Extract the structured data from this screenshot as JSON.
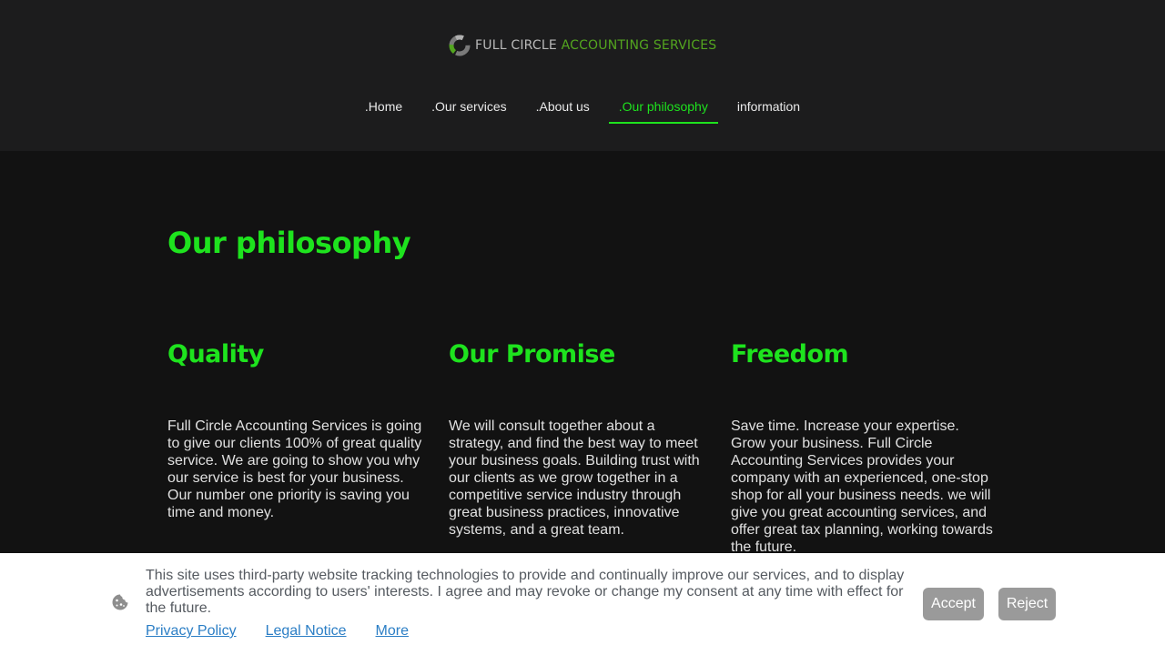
{
  "logo": {
    "part1": "FULL CIRCLE ",
    "part2": "ACCOUNTING SERVICES"
  },
  "nav": [
    {
      "label": ".Home"
    },
    {
      "label": ".Our services"
    },
    {
      "label": ".About us"
    },
    {
      "label": ".Our philosophy",
      "active": true
    },
    {
      "label": "information"
    }
  ],
  "page": {
    "title": "Our philosophy"
  },
  "columns": [
    {
      "heading": "Quality",
      "text": "Full Circle Accounting Services is going to give our clients 100% of great quality service. We are going to show you why our service is best for your business. Our number one priority is saving you time and money."
    },
    {
      "heading": "Our Promise",
      "text": "We will consult together about a strategy, and find the best way to meet your business goals. Building trust with our clients as we grow together in a competitive service industry through great business practices, innovative systems, and a great team."
    },
    {
      "heading": "Freedom",
      "text": "Save time. Increase your expertise. Grow your business. Full Circle Accounting Services provides your company with an experienced, one-stop shop for all your business needs. we will give you great accounting services, and offer great tax planning, working towards the future."
    }
  ],
  "cookie": {
    "text": "This site uses third-party website tracking technologies to provide and continually improve our services, and to display advertisements according to users' interests. I agree and may revoke or change my consent at any time with effect for the future.",
    "links": [
      "Privacy Policy",
      "Legal Notice",
      "More"
    ],
    "accept": "Accept",
    "reject": "Reject"
  },
  "icons": {
    "logo": "circle-arrows-logo-icon",
    "cookie": "cookie-icon"
  },
  "colors": {
    "accent": "#1ee31e",
    "logo_green": "#53a51f",
    "header_bg": "#1c1c1d",
    "page_bg": "#121212",
    "button": "#9a9a9a",
    "link": "#2b7ec5"
  }
}
